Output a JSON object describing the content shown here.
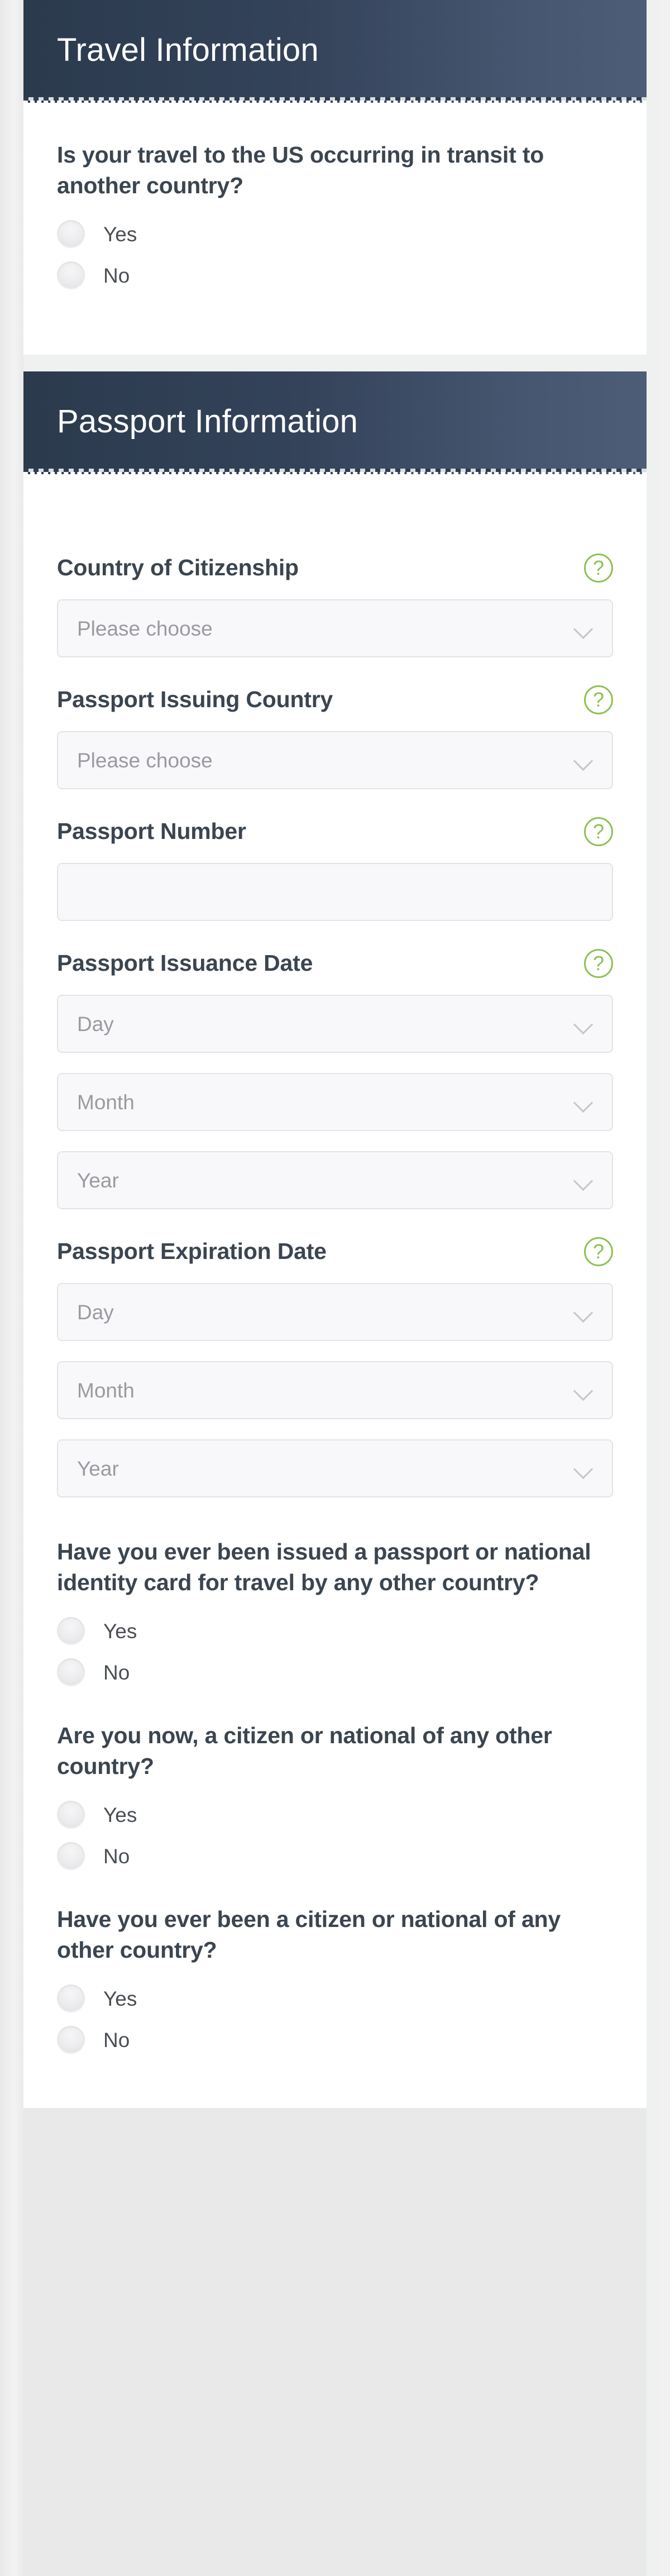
{
  "sections": [
    {
      "id": "travel-information",
      "title": "Travel Information",
      "questions": [
        {
          "text": "Is your travel to the US occurring in transit to another country?",
          "options": [
            "Yes",
            "No"
          ]
        }
      ]
    },
    {
      "id": "passport-information",
      "title": "Passport Information",
      "fields": [
        {
          "label": "Country of Citizenship",
          "help_icon": "question-mark-icon",
          "control": "select",
          "value": "Please choose"
        },
        {
          "label": "Passport Issuing Country",
          "help_icon": "question-mark-icon",
          "control": "select",
          "value": "Please choose"
        },
        {
          "label": "Passport Number",
          "help_icon": "question-mark-icon",
          "control": "text",
          "value": ""
        },
        {
          "label": "Passport Issuance Date",
          "help_icon": "question-mark-icon",
          "control": "date-group",
          "parts": [
            "Day",
            "Month",
            "Year"
          ]
        },
        {
          "label": "Passport Expiration Date",
          "help_icon": "question-mark-icon",
          "control": "date-group",
          "parts": [
            "Day",
            "Month",
            "Year"
          ]
        }
      ],
      "questions": [
        {
          "text": "Have you ever been issued a passport or national identity card for travel by any other country?",
          "options": [
            "Yes",
            "No"
          ]
        },
        {
          "text": "Are you now, a citizen or national of any other country?",
          "options": [
            "Yes",
            "No"
          ]
        },
        {
          "text": "Have you ever been a citizen or national of any other country?",
          "options": [
            "Yes",
            "No"
          ]
        }
      ]
    }
  ],
  "colors": {
    "header_gradient_start": "#2b3a4d",
    "header_gradient_end": "#4d5c77",
    "help_icon": "#8cc152",
    "label_text": "#3b4550",
    "placeholder_text": "#9a9ba0",
    "field_background": "#f8f8fa",
    "page_background": "#eff0f0"
  },
  "icons": {
    "help": "?",
    "chevron_down": "chevron-down-icon"
  }
}
